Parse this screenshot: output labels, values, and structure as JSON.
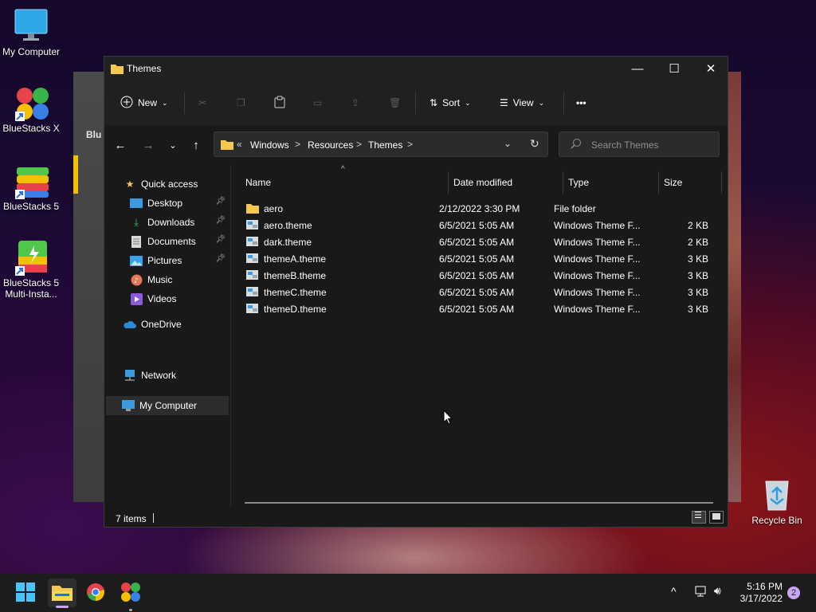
{
  "desktop": {
    "icons": [
      {
        "label": "My Computer"
      },
      {
        "label": "BlueStacks X"
      },
      {
        "label": "BlueStacks 5"
      },
      {
        "label": "BlueStacks 5 Multi-Insta..."
      },
      {
        "label": "Recycle Bin"
      }
    ],
    "background_app_text": "Blu"
  },
  "window": {
    "title": "Themes",
    "controls": {
      "minimize": "—",
      "maximize": "☐",
      "close": "✕"
    }
  },
  "toolbar": {
    "new_label": "New",
    "sort_label": "Sort",
    "view_label": "View",
    "more_label": "•••"
  },
  "address": {
    "overflow": "«",
    "crumbs": [
      "Windows",
      "Resources",
      "Themes"
    ],
    "separator": ">"
  },
  "search": {
    "placeholder": "Search Themes"
  },
  "sidebar": {
    "items": [
      {
        "label": "Quick access",
        "icon": "star-icon"
      },
      {
        "label": "Desktop",
        "icon": "desktop-icon",
        "pinned": true
      },
      {
        "label": "Downloads",
        "icon": "download-icon",
        "pinned": true
      },
      {
        "label": "Documents",
        "icon": "document-icon",
        "pinned": true
      },
      {
        "label": "Pictures",
        "icon": "pictures-icon",
        "pinned": true
      },
      {
        "label": "Music",
        "icon": "music-icon"
      },
      {
        "label": "Videos",
        "icon": "videos-icon"
      },
      {
        "label": "OneDrive",
        "icon": "cloud-icon"
      },
      {
        "label": "My Computer",
        "icon": "computer-icon",
        "selected": true
      },
      {
        "label": "Network",
        "icon": "network-icon"
      }
    ]
  },
  "columns": {
    "name": "Name",
    "date": "Date modified",
    "type": "Type",
    "size": "Size"
  },
  "files": [
    {
      "name": "aero",
      "date": "2/12/2022 3:30 PM",
      "type": "File folder",
      "size": "",
      "kind": "folder"
    },
    {
      "name": "aero.theme",
      "date": "6/5/2021 5:05 AM",
      "type": "Windows Theme F...",
      "size": "2 KB",
      "kind": "theme"
    },
    {
      "name": "dark.theme",
      "date": "6/5/2021 5:05 AM",
      "type": "Windows Theme F...",
      "size": "2 KB",
      "kind": "theme"
    },
    {
      "name": "themeA.theme",
      "date": "6/5/2021 5:05 AM",
      "type": "Windows Theme F...",
      "size": "3 KB",
      "kind": "theme"
    },
    {
      "name": "themeB.theme",
      "date": "6/5/2021 5:05 AM",
      "type": "Windows Theme F...",
      "size": "3 KB",
      "kind": "theme"
    },
    {
      "name": "themeC.theme",
      "date": "6/5/2021 5:05 AM",
      "type": "Windows Theme F...",
      "size": "3 KB",
      "kind": "theme"
    },
    {
      "name": "themeD.theme",
      "date": "6/5/2021 5:05 AM",
      "type": "Windows Theme F...",
      "size": "3 KB",
      "kind": "theme"
    }
  ],
  "status": {
    "item_count": "7 items"
  },
  "taskbar": {
    "apps": [
      "start-icon",
      "file-explorer-icon",
      "chrome-icon",
      "bluestacks-x-icon"
    ],
    "time": "5:16 PM",
    "date": "3/17/2022",
    "notifications": "2"
  },
  "colors": {
    "window_bg": "#191919",
    "titlebar_bg": "#202020",
    "folder_yellow": "#f2c94c",
    "accent_blue": "#4cc2ff"
  }
}
